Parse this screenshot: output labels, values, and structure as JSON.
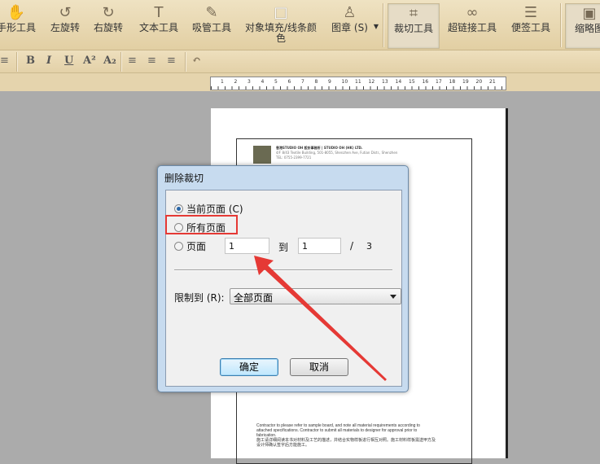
{
  "toolbar": {
    "items": [
      {
        "label": "手形工具",
        "icon": "hand-icon",
        "glyph": "✋"
      },
      {
        "label": "左旋转",
        "icon": "rotate-left-icon",
        "glyph": "↺"
      },
      {
        "label": "右旋转",
        "icon": "rotate-right-icon",
        "glyph": "↻"
      },
      {
        "label": "文本工具",
        "icon": "text-icon",
        "glyph": "T"
      },
      {
        "label": "吸管工具",
        "icon": "eyedropper-icon",
        "glyph": "✎"
      },
      {
        "label": "对象填充/线条颜色",
        "icon": "fill-icon",
        "glyph": "□"
      },
      {
        "label": "图章 (S)",
        "icon": "stamp-icon",
        "glyph": "♙"
      },
      {
        "label": "裁切工具",
        "icon": "crop-icon",
        "glyph": "⌗"
      },
      {
        "label": "超链接工具",
        "icon": "link-icon",
        "glyph": "∞"
      },
      {
        "label": "便签工具",
        "icon": "note-icon",
        "glyph": "☰"
      },
      {
        "label": "缩略图",
        "icon": "thumbnail-icon",
        "glyph": "▣"
      }
    ]
  },
  "format": {
    "bold": "B",
    "italic": "I",
    "underline": "U",
    "superscript": "A²",
    "subscript": "A₂"
  },
  "ruler": [
    "1",
    "2",
    "3",
    "4",
    "5",
    "6",
    "7",
    "8",
    "9",
    "10",
    "11",
    "12",
    "13",
    "14",
    "15",
    "16",
    "17",
    "18",
    "19",
    "20",
    "21"
  ],
  "document": {
    "header_company": "香港STUDIO OH 設計事務所 | STUDIO OH (HK) LTD.",
    "header_address": "4/F 8/43 Textile Building, 501-8055, Shenzhen Ave, Futian Distr., Shenzhen",
    "header_tel": "TEL: 0755-2399-7721",
    "footer_en": "Contractor to please refer to sample board, and note all material requirements according to attached specifications. Contractor to submit all materials to designer for approval prior to fabrication.",
    "footer_cn": "施工请详细阅读本书对材料及工艺的描述，并结合实物样板进行相互对照。施工材料样板需送甲方及设计师确认签字后方能施工。"
  },
  "dialog": {
    "title": "删除裁切",
    "opt_current": "当前页面 (C)",
    "opt_all": "所有页面",
    "opt_range": "页面",
    "from": "1",
    "to_label": "到",
    "to": "1",
    "slash": "/",
    "total": "3",
    "limit_label": "限制到 (R):",
    "limit_value": "全部页面",
    "ok": "确定",
    "cancel": "取消"
  },
  "colors": {
    "highlight": "#e53935"
  }
}
